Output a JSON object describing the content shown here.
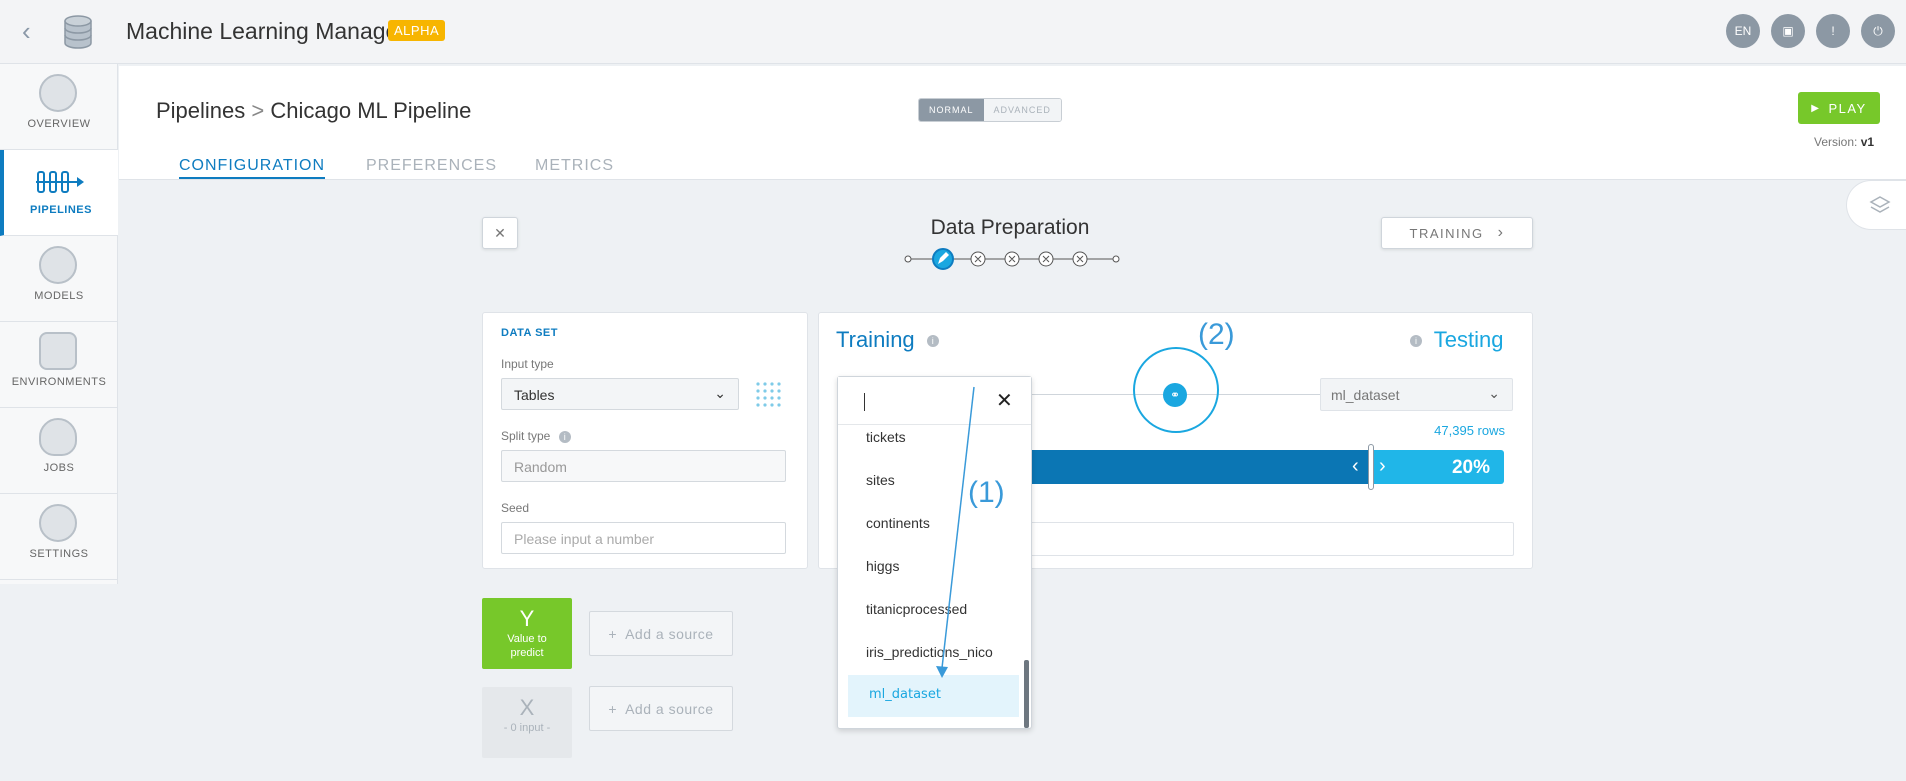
{
  "header": {
    "title": "Machine Learning Manager",
    "badge": "ALPHA",
    "lang": "EN"
  },
  "sidebar": {
    "items": [
      {
        "label": "OVERVIEW"
      },
      {
        "label": "PIPELINES"
      },
      {
        "label": "MODELS"
      },
      {
        "label": "ENVIRONMENTS"
      },
      {
        "label": "JOBS"
      },
      {
        "label": "SETTINGS"
      }
    ]
  },
  "breadcrumb": {
    "root": "Pipelines",
    "sep": ">",
    "current": "Chicago ML Pipeline"
  },
  "mode": {
    "normal": "NORMAL",
    "advanced": "ADVANCED"
  },
  "play": {
    "label": "PLAY"
  },
  "version": {
    "label": "Version:",
    "value": "v1"
  },
  "tabs": [
    {
      "label": "CONFIGURATION"
    },
    {
      "label": "PREFERENCES"
    },
    {
      "label": "METRICS"
    }
  ],
  "step": {
    "title": "Data Preparation",
    "next": "TRAINING",
    "close": "✕"
  },
  "dataset": {
    "heading": "DATA SET",
    "input_type_label": "Input type",
    "input_type_value": "Tables",
    "split_type_label": "Split type",
    "split_type_value": "Random",
    "seed_label": "Seed",
    "seed_placeholder": "Please input a number"
  },
  "split": {
    "training": "Training",
    "testing": "Testing",
    "testing_table": "ml_dataset",
    "rows": "47,395 rows",
    "test_percent": "20%",
    "test_fraction": 0.2
  },
  "targets": {
    "y_letter": "Y",
    "y_text": "Value to predict",
    "x_letter": "X",
    "x_text": "- 0 input -",
    "add_source": "Add a source"
  },
  "dropdown": {
    "items": [
      "tickets",
      "sites",
      "continents",
      "higgs",
      "titanicprocessed",
      "iris_predictions_nico",
      "ml_dataset"
    ]
  },
  "annotations": {
    "one": "(1)",
    "two": "(2)"
  }
}
